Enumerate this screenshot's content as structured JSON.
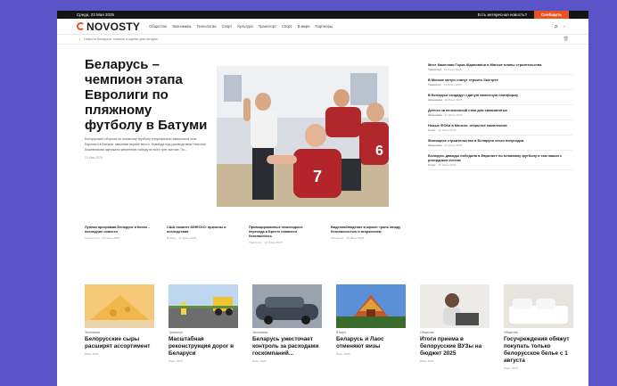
{
  "topbar": {
    "date": "Среда, 23 Мая 2025",
    "news_question": "Есть интересная новость?",
    "tip_button": "Сообщить"
  },
  "header": {
    "logo": "NOVOSTY",
    "nav": [
      "Общество",
      "Экономика",
      "Технологии",
      "Спорт",
      "Культура",
      "Транспорт",
      "Спорт",
      "В мире",
      "Партнеры"
    ],
    "search_icon": "search-icon",
    "mini_text": "0 ∷"
  },
  "breadcrumb": {
    "text": "Новости Беларуси: главное и оценки дня сегодня",
    "trash": "🗑"
  },
  "lead": {
    "title": "Беларусь – чемпион этапа Евролиги по пляжному футболу в Батуми",
    "summary": "Белорусские сборная по пляжному футболу триумфально завершила этап Евролиги в Батуми, завоевав первое место. Команда под руководством Николая Кожевникова одержала уверенную победу во всех трех матчах. По...",
    "date": "23 Мая 2025"
  },
  "side": [
    {
      "title": "Мост Каменная Горка-Жданови́чи в Минске планы строительства",
      "cat": "Транспорт",
      "date": "22 Июня 2025"
    },
    {
      "title": "В Минске метро станут строить быстрее",
      "cat": "Транспорт",
      "date": "22 Июня 2025"
    },
    {
      "title": "В Беларуси создадут единую валютную платформу",
      "cat": "Экономика",
      "date": "22 Июня 2025"
    },
    {
      "title": "Деньги за пенсионный стаж для самозанятых",
      "cat": "Экономика",
      "date": "22 Июня 2025"
    },
    {
      "title": "Новые ФОКи в Минске: открытие комплексов",
      "cat": "Спорт",
      "date": "21 Июня 2025"
    },
    {
      "title": "Жилищное строительство в Беларуси итоги полугодия",
      "cat": "Экономика",
      "date": "21 Июня 2025"
    },
    {
      "title": "Беларусь дважды победила в Евролиге по пляжному футболу и там наших с рекордным счетом",
      "cat": "Спорт",
      "date": "20 Июня 2025"
    }
  ],
  "mini_news": [
    {
      "title": "Лунная программа Беларуси и Китая – последние новости",
      "cat": "Технологии",
      "date": "22 Июнь 2025"
    },
    {
      "title": "США покинет ЮНЕСКО: причины и последствия",
      "cat": "В Мире",
      "date": "22 Июнь 2025"
    },
    {
      "title": "Провоцированных пешеходных перехода в Бресте появится безопасность",
      "cat": "Транспорт",
      "date": "22 Июнь 2025"
    },
    {
      "title": "Видеонаблюдение в офисе: грань между безопасностью и вторжением",
      "cat": "Общество",
      "date": "20 Июнь 2025"
    }
  ],
  "cards": [
    {
      "cat": "Экономика",
      "title": "Белорусские сыры расширят ассортимент",
      "date": "Июнь 2025",
      "img": "cheese"
    },
    {
      "cat": "Транспорт",
      "title": "Масштабная реконструкция дорог в Беларуси",
      "date": "Июнь 2025",
      "img": "road"
    },
    {
      "cat": "Экономика",
      "title": "Беларусь ужесточает контроль за расходами госкомпаний...",
      "date": "Июнь 2025",
      "img": "cars"
    },
    {
      "cat": "В мире",
      "title": "Беларусь и Лаос отменяют визы",
      "date": "Июнь 2025",
      "img": "temple"
    },
    {
      "cat": "Общество",
      "title": "Итоги приема в белорусские ВУЗы на бюджет 2025",
      "date": "Июнь 2025",
      "img": "student"
    },
    {
      "cat": "Общество",
      "title": "Госучреждения обяжут покупать только белорусское белье с 1 августа",
      "date": "Июнь 2025",
      "img": "bedding"
    }
  ]
}
